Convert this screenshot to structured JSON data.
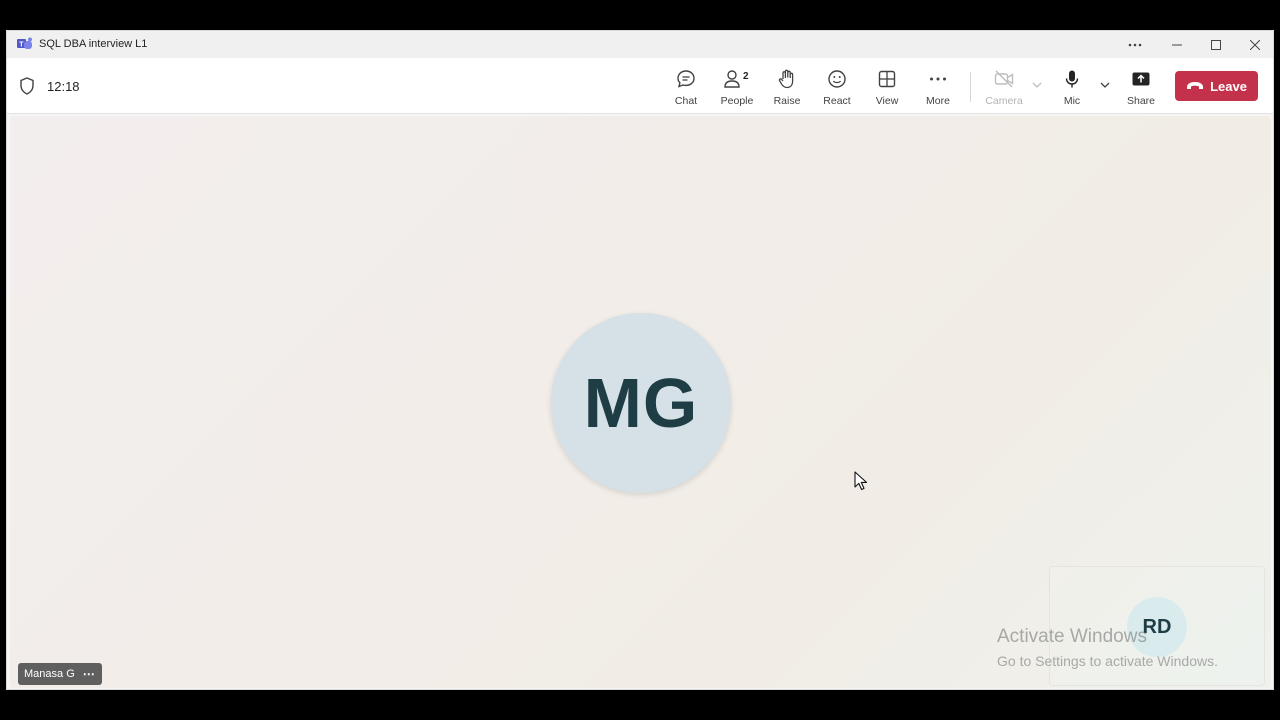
{
  "window": {
    "title": "SQL DBA interview L1",
    "controls": [
      "more",
      "minimize",
      "maximize",
      "close"
    ]
  },
  "toolbar": {
    "time": "12:18",
    "buttons": {
      "chat": "Chat",
      "people": "People",
      "people_count": "2",
      "raise": "Raise",
      "react": "React",
      "view": "View",
      "more": "More",
      "camera": "Camera",
      "mic": "Mic",
      "share": "Share"
    },
    "leave": "Leave"
  },
  "stage": {
    "main_avatar_initials": "MG",
    "self_avatar_initials": "RD",
    "participant_name": "Manasa G",
    "name_menu": "⋯"
  },
  "watermark": {
    "title": "Activate Windows",
    "subtitle": "Go to Settings to activate Windows."
  },
  "colors": {
    "leave_button": "#c4314b",
    "teams_purple": "#5059c9",
    "avatar_main_bg": "#d5e1e6",
    "avatar_text": "#1f3d45"
  }
}
